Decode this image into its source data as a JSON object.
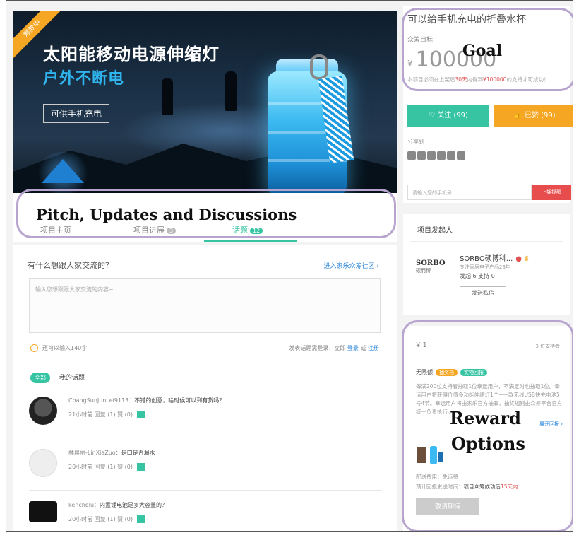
{
  "hero": {
    "ribbon": "筹款中",
    "title_plain": "太阳能移动电源",
    "title_bold": "伸缩灯",
    "subtitle": "户外不断电",
    "button": "可供手机充电"
  },
  "annotations": {
    "goal": "Goal",
    "pitch": "Pitch, Updates and Discussions",
    "reward_line1": "Reward",
    "reward_line2": "Options"
  },
  "tabs": [
    {
      "label": "项目主页",
      "badge": ""
    },
    {
      "label": "项目进展",
      "badge": "3"
    },
    {
      "label": "话题",
      "badge": "12"
    }
  ],
  "discussion": {
    "question": "有什么想跟大家交流的？",
    "community_link": "进入家乐众筹社区 ›",
    "placeholder": "输入您想跟跟大家交流的内容~",
    "char_tip": "还可以输入140字",
    "login_prefix": "发表话题需登录，立即",
    "login_link": "登录",
    "or": "或",
    "register_link": "注册",
    "filter_all": "全部",
    "filter_mine": "我的话题"
  },
  "posts": [
    {
      "user": "ChangSunJunLei9113：",
      "message": "不错的创意，啥时候可以到有货吗？",
      "meta": "21小时前    回复 (1)    赞 (0)"
    },
    {
      "user": "林晨丽-LinXiaZuo：",
      "message": "是口是否漏水",
      "meta": "20小时前    回复 (1)    赞 (0)"
    },
    {
      "user": "kenchelu：",
      "message": "内置锂电池是多大容量的？",
      "meta": "20小时前    回复 (1)    赞 (0)"
    }
  ],
  "project": {
    "title": "可以给手机充电的折叠水杯",
    "goal_label": "众筹目标",
    "currency": "¥",
    "goal": "100000",
    "note_a": "本项目必须在上架后",
    "note_days": "30天",
    "note_b": "内得到",
    "note_amount": "¥100000",
    "note_c": "的支持才可成功！",
    "follow": "♡ 关注 (99)",
    "like": "👍 已赞 (99)",
    "share_label": "分享到",
    "phone_placeholder": "请输入您的手机号",
    "phone_button": "上架提醒"
  },
  "sponsor": {
    "heading": "项目发起人",
    "logo": "SORBO",
    "logo_sub": "硕而博",
    "name": "SORBO硕博科...",
    "desc": "专注家居电子产品23年",
    "stats": "发起 6    支持 0",
    "message_btn": "发送私信"
  },
  "reward": {
    "amount": "¥ 1",
    "count": "3 位支持者",
    "title": "无限额",
    "tag1": "抽奖档",
    "tag2": "实物回报",
    "desc": "每满200位支持者抽取1位幸运用户，不满足时也抽取1位。幸运用户将获得价值多功能伸缩灯1个+一款无线USB快充电池5号4节。幸运用户将由家乐官方抽取，抽奖规则由众筹平台官方统一负责执行。",
    "more": "展开回报 ›",
    "ship": "配送费用：免运费",
    "time_prefix": "预计回报发送时间：",
    "time_b": "项目众筹成功后",
    "time_r": "15天内",
    "button": "敬请期待"
  },
  "colors": {
    "accent": "#37c4a3",
    "orange": "#f5a623",
    "red": "#e84d4d",
    "annotation": "#b7a5cf"
  }
}
